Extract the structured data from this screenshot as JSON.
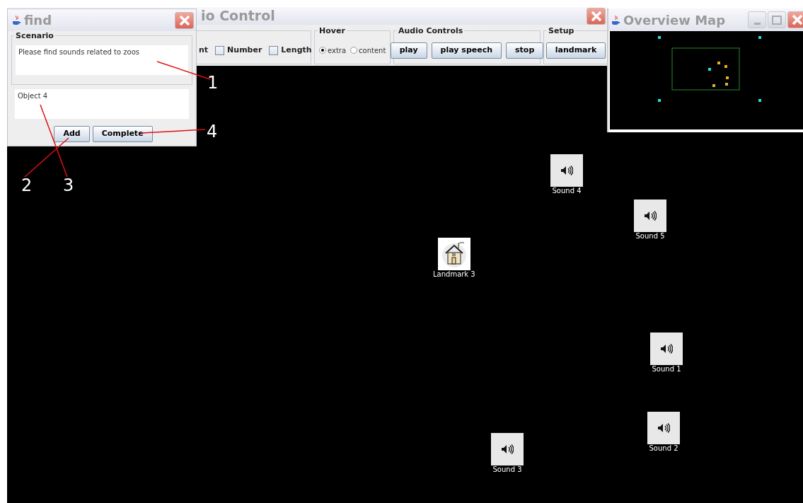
{
  "main_window": {
    "title": "io Control"
  },
  "toolbar": {
    "cut_label": "nt",
    "checkboxes": [
      {
        "label": "Number",
        "checked": false
      },
      {
        "label": "Length",
        "checked": false
      }
    ],
    "hover": {
      "title": "Hover",
      "options": [
        {
          "label": "extra",
          "selected": true
        },
        {
          "label": "content",
          "selected": false
        }
      ]
    },
    "audio_controls": {
      "title": "Audio Controls",
      "buttons": [
        "play",
        "play speech",
        "stop"
      ]
    },
    "setup": {
      "title": "Setup",
      "buttons": [
        "landmark"
      ]
    }
  },
  "find_dialog": {
    "title": "find",
    "scenario_title": "Scenario",
    "scenario_text": "Please find sounds related to zoos",
    "object_text": "Object 4",
    "buttons": [
      "Add",
      "Complete"
    ]
  },
  "overview_map": {
    "title": "Overview Map"
  },
  "canvas_nodes": [
    {
      "kind": "sound",
      "label": "Sound 4"
    },
    {
      "kind": "sound",
      "label": "Sound 5"
    },
    {
      "kind": "landmark",
      "label": "Landmark 3"
    },
    {
      "kind": "sound",
      "label": "Sound 1"
    },
    {
      "kind": "sound",
      "label": "Sound 2"
    },
    {
      "kind": "sound",
      "label": "Sound 3"
    }
  ],
  "annotations": [
    "1",
    "2",
    "3",
    "4"
  ]
}
